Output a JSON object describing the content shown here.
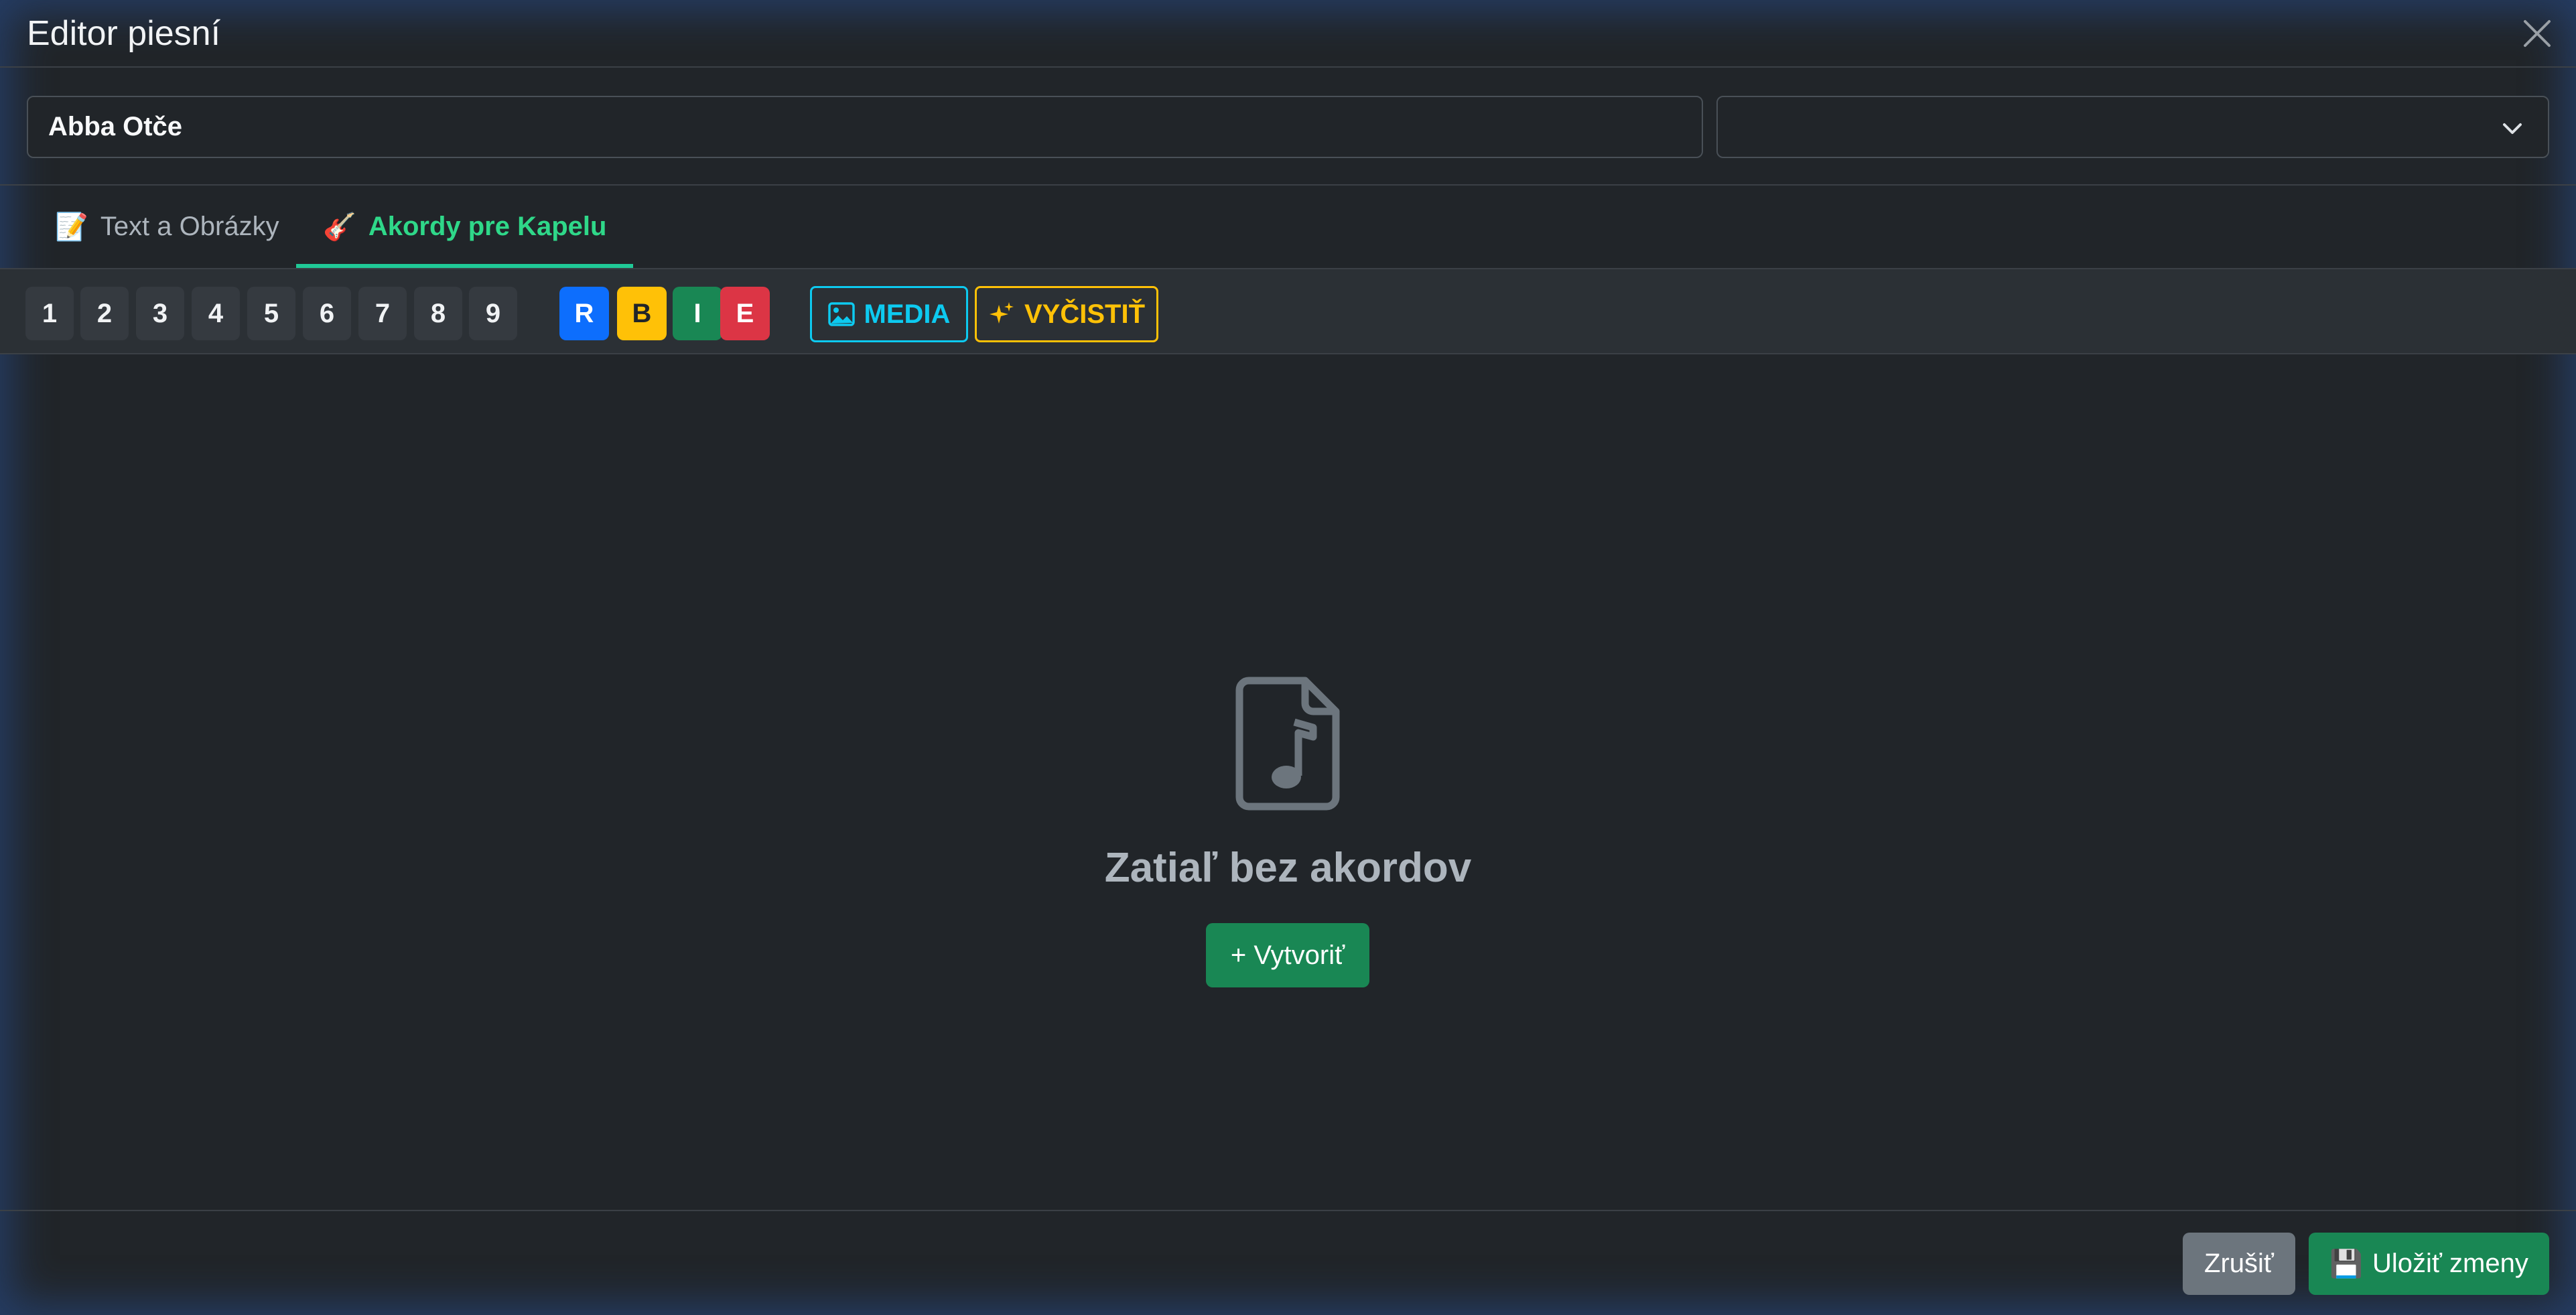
{
  "header": {
    "title": "Editor piesní",
    "close_icon": "close-icon"
  },
  "form": {
    "title_value": "Abba Otče",
    "select_value": ""
  },
  "tabs": [
    {
      "icon": "📝",
      "label": "Text a Obrázky",
      "active": false
    },
    {
      "icon": "🎸",
      "label": "Akordy pre Kapelu",
      "active": true
    }
  ],
  "toolbar": {
    "numbers": [
      "1",
      "2",
      "3",
      "4",
      "5",
      "6",
      "7",
      "8",
      "9"
    ],
    "formats": [
      {
        "label": "R",
        "color": "#0d6efd",
        "text_color": "#ffffff"
      },
      {
        "label": "B",
        "color": "#ffc107",
        "text_color": "#212529"
      },
      {
        "label": "I",
        "color": "#198754",
        "text_color": "#ffffff"
      },
      {
        "label": "E",
        "color": "#dc3545",
        "text_color": "#ffffff"
      }
    ],
    "media_label": "MEDIA",
    "media_color": "#0dcaf0",
    "clean_label": "VYČISTIŤ",
    "clean_color": "#ffc107"
  },
  "empty_state": {
    "icon": "music-file-icon",
    "text": "Zatiaľ bez akordov",
    "create_label": "+ Vytvoriť"
  },
  "footer": {
    "cancel_label": "Zrušiť",
    "save_icon": "💾",
    "save_label": "Uložiť zmeny"
  }
}
